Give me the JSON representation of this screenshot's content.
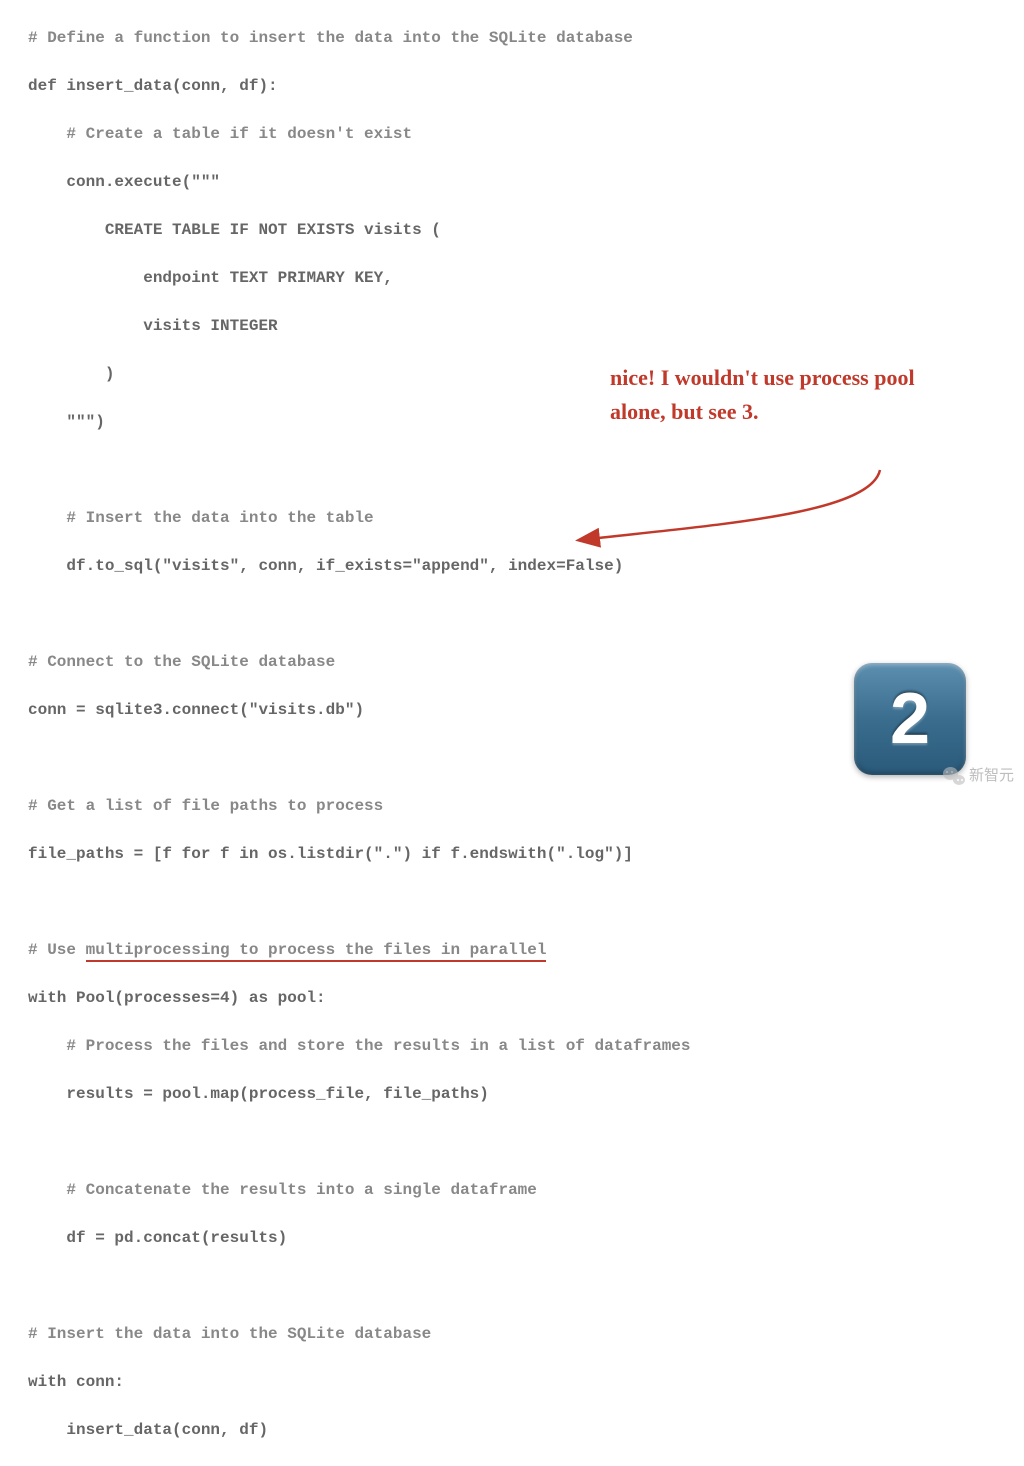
{
  "code": {
    "l01": "# Define a function to insert the data into the SQLite database",
    "l02a": "def",
    "l02b": " insert_data(conn, df):",
    "l03": "    # Create a table if it doesn't exist",
    "l04": "    conn.execute(\"\"\"",
    "l05": "        CREATE TABLE IF NOT EXISTS visits (",
    "l06": "            endpoint TEXT PRIMARY KEY,",
    "l07": "            visits INTEGER",
    "l08": "        )",
    "l09": "    \"\"\")",
    "l10": "",
    "l11": "    # Insert the data into the table",
    "l12": "    df.to_sql(\"visits\", conn, if_exists=\"append\", index=False)",
    "l13": "",
    "l14": "# Connect to the SQLite database",
    "l15": "conn = sqlite3.connect(\"visits.db\")",
    "l16": "",
    "l17": "# Get a list of file paths to process",
    "l18": "file_paths = [f for f in os.listdir(\".\") if f.endswith(\".log\")]",
    "l19": "",
    "l20a": "# Use ",
    "l20b": "multiprocessing to process the files in parallel",
    "l21": "with Pool(processes=4) as pool:",
    "l22": "    # Process the files and store the results in a list of dataframes",
    "l23": "    results = pool.map(process_file, file_paths)",
    "l24": "",
    "l25": "    # Concatenate the results into a single dataframe",
    "l26": "    df = pd.concat(results)",
    "l27": "",
    "l28": "# Insert the data into the SQLite database",
    "l29": "with conn:",
    "l30": "    insert_data(conn, df)"
  },
  "annotation": {
    "text": "nice! I wouldn't use process pool alone, but see 3.",
    "arrow_color": "#c0392b"
  },
  "badge": {
    "number": "2",
    "bg_gradient_top": "#5c8fb0",
    "bg_gradient_bottom": "#2a5a7a"
  },
  "watermark": {
    "icon": "wechat-icon",
    "text": "新智元"
  }
}
